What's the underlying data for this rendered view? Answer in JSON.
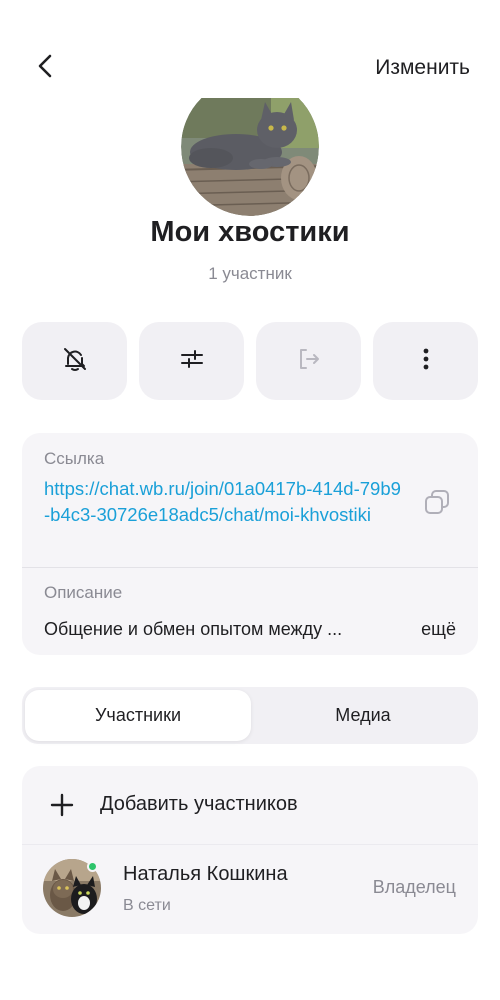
{
  "header": {
    "back_icon": "chevron-left-icon",
    "edit_label": "Изменить"
  },
  "group": {
    "avatar": "cat-photo",
    "title": "Мои хвостики",
    "members_count": "1 участник"
  },
  "actions": [
    {
      "icon": "bell-off-icon"
    },
    {
      "icon": "sliders-icon"
    },
    {
      "icon": "exit-icon",
      "disabled": true
    },
    {
      "icon": "more-vertical-icon"
    }
  ],
  "info": {
    "link_label": "Ссылка",
    "link_url": "https://chat.wb.ru/join/01a0417b-414d-79b9-b4c3-30726e18adc5/chat/moi-khvostiki",
    "copy_icon": "copy-icon",
    "description_label": "Описание",
    "description_text": "Общение и обмен опытом между ...",
    "more_label": "ещё"
  },
  "tabs": [
    {
      "label": "Участники",
      "active": true
    },
    {
      "label": "Медиа",
      "active": false
    }
  ],
  "members": {
    "add_label": "Добавить участников",
    "add_icon": "plus-icon",
    "list": [
      {
        "name": "Наталья Кошкина",
        "status": "В сети",
        "role": "Владелец",
        "online": true,
        "online_color": "#2ec46b"
      }
    ]
  },
  "colors": {
    "link": "#1aa0d8",
    "text": "#1f1f22",
    "secondary": "#8a8a93",
    "surface": "#f6f5f8",
    "button_surface": "#f1f0f4"
  }
}
